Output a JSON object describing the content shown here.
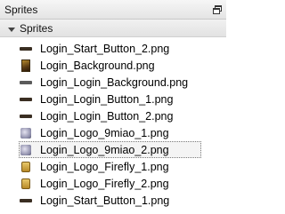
{
  "window": {
    "title": "Sprites",
    "dock_icon": "restore-window-icon"
  },
  "group": {
    "label": "Sprites",
    "expander_icon": "triangle-down-icon"
  },
  "items": [
    {
      "label": "Login_Start_Button_2.png",
      "icon": "button-sprite-icon"
    },
    {
      "label": "Login_Background.png",
      "icon": "background-sprite-icon"
    },
    {
      "label": "Login_Login_Background.png",
      "icon": "bar-sprite-icon"
    },
    {
      "label": "Login_Login_Button_1.png",
      "icon": "button-sprite-icon"
    },
    {
      "label": "Login_Login_Button_2.png",
      "icon": "button-sprite-icon"
    },
    {
      "label": "Login_Logo_9miao_1.png",
      "icon": "logo-sprite-icon"
    },
    {
      "label": "Login_Logo_9miao_2.png",
      "icon": "logo-sprite-icon",
      "selected": true
    },
    {
      "label": "Login_Logo_Firefly_1.png",
      "icon": "firefly-logo-sprite-icon"
    },
    {
      "label": "Login_Logo_Firefly_2.png",
      "icon": "firefly-logo-sprite-icon"
    },
    {
      "label": "Login_Start_Button_1.png",
      "icon": "button-sprite-icon"
    }
  ]
}
